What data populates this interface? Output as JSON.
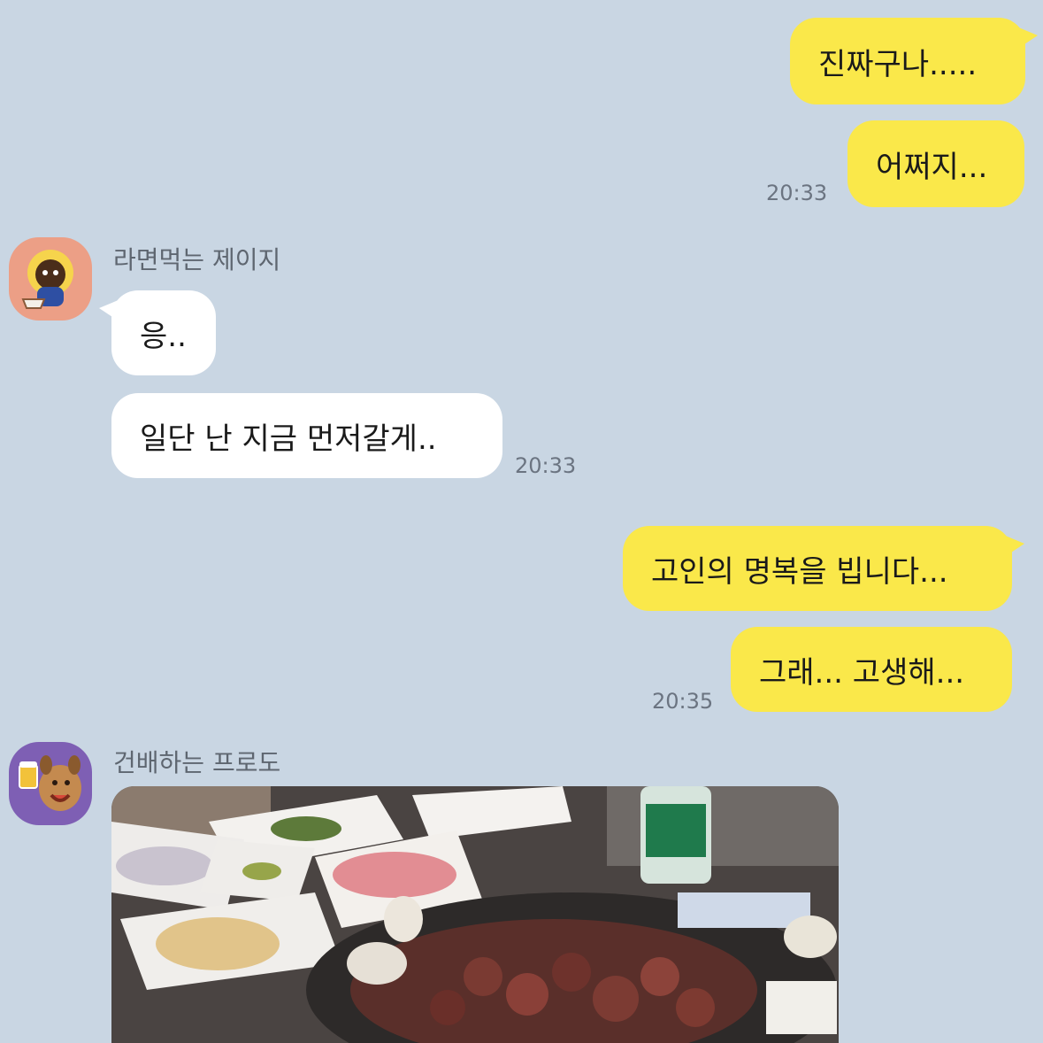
{
  "messages": {
    "m1": "진짜구나.....",
    "m2": "어쩌지...",
    "t1": "20:33",
    "sender1": "라면먹는 제이지",
    "m3": "응..",
    "m4": "일단 난 지금 먼저갈게..",
    "t2": "20:33",
    "m5": "고인의 명복을 빕니다...",
    "m6": "그래... 고생해...",
    "t3": "20:35",
    "sender2": "건배하는 프로도"
  },
  "avatars": {
    "jayg": {
      "icon": "ramen-jayg-avatar",
      "bg": "#ec9f86"
    },
    "frodo": {
      "icon": "cheers-frodo-avatar",
      "bg": "#7e5fb4"
    }
  },
  "colors": {
    "background": "#c9d6e3",
    "mine_bubble": "#fae84a",
    "their_bubble": "#ffffff"
  }
}
